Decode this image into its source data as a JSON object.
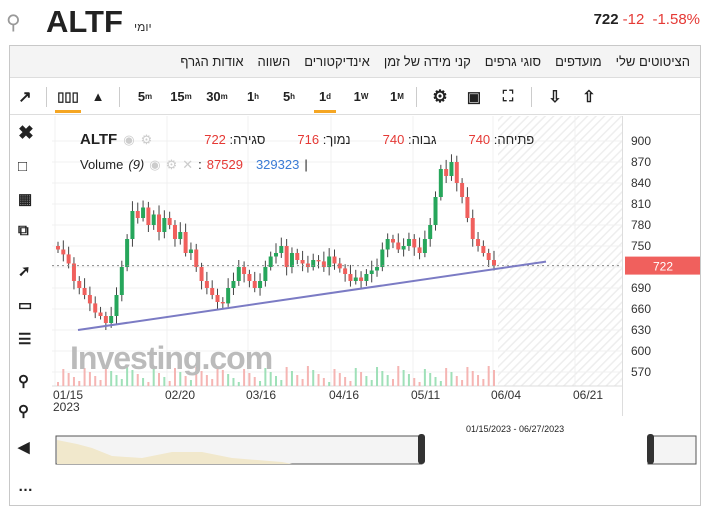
{
  "header": {
    "symbol": "ALTF",
    "period": "יומי",
    "price": "722",
    "change": "-12",
    "change_pct": "-1.58%"
  },
  "menu": [
    "אודות הגרף",
    "השווה",
    "אינדיקטורים",
    "קני מידה של זמן",
    "סוגי גרפים",
    "מועדפים",
    "הציטוטים שלי"
  ],
  "toolbar": {
    "intervals": [
      {
        "n": "5",
        "s": "m"
      },
      {
        "n": "15",
        "s": "m"
      },
      {
        "n": "30",
        "s": "m"
      },
      {
        "n": "1",
        "s": "h"
      },
      {
        "n": "5",
        "s": "h"
      },
      {
        "n": "1",
        "s": "d"
      },
      {
        "n": "1",
        "s": "W"
      },
      {
        "n": "1",
        "s": "M"
      }
    ],
    "selected_interval": "1d",
    "selected_type": "candles"
  },
  "legend": {
    "symbol": "ALTF",
    "close_label": "סגירה:",
    "close": "722",
    "low_label": "נמוך:",
    "low": "716",
    "high_label": "גבוה:",
    "high": "740",
    "open_label": "פתיחה:",
    "open": "740",
    "volume_label": "Volume",
    "volume_param": "(9)",
    "volume_value": "87529",
    "volume_ma": "329323"
  },
  "watermark": "Investing.com",
  "colors": {
    "up": "#26a65b",
    "down": "#f0605d",
    "trend": "#7b7bc4",
    "price_tag": "#f0605d"
  },
  "chart_data": {
    "type": "candlestick",
    "yticks": [
      900,
      870,
      840,
      810,
      780,
      750,
      720,
      690,
      660,
      630,
      600,
      570
    ],
    "ylim": [
      555,
      910
    ],
    "current": 722,
    "xticks": [
      "01/15",
      "02/20",
      "03/16",
      "04/16",
      "05/11",
      "06/04",
      "06/21"
    ],
    "xtick_sub": "2023",
    "closes": [
      745,
      738,
      725,
      700,
      690,
      680,
      668,
      655,
      650,
      640,
      650,
      680,
      720,
      760,
      800,
      790,
      805,
      780,
      795,
      770,
      790,
      780,
      760,
      770,
      740,
      745,
      720,
      700,
      690,
      680,
      670,
      668,
      690,
      700,
      720,
      710,
      700,
      690,
      700,
      720,
      735,
      740,
      750,
      720,
      740,
      730,
      725,
      720,
      730,
      728,
      720,
      735,
      725,
      718,
      710,
      700,
      705,
      700,
      710,
      715,
      720,
      745,
      760,
      755,
      745,
      750,
      760,
      748,
      740,
      760,
      780,
      820,
      860,
      850,
      870,
      840,
      820,
      790,
      760,
      750,
      740,
      730,
      722
    ],
    "trendline": [
      [
        0,
        630
      ],
      [
        1,
        722
      ]
    ]
  },
  "range": {
    "label": "01/15/2023 - 06/27/2023"
  }
}
